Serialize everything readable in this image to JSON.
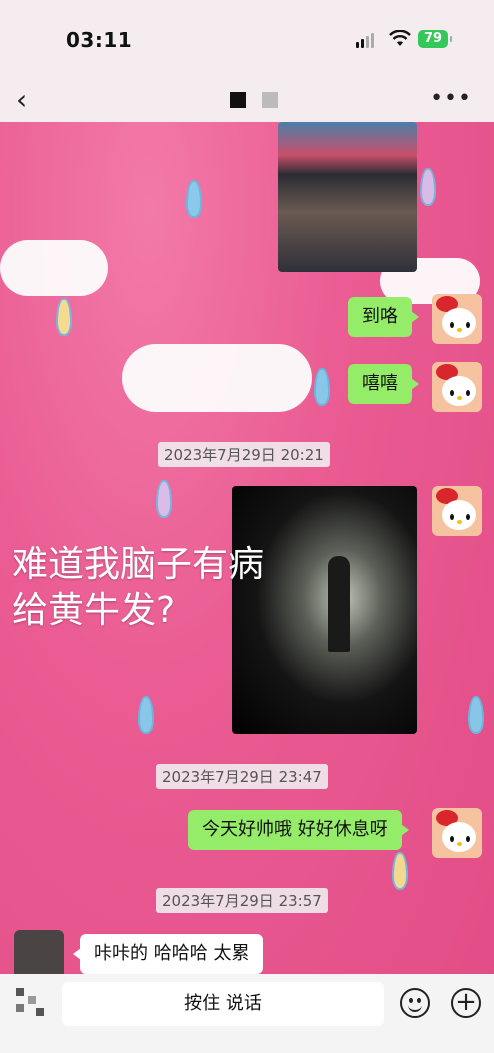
{
  "status_bar": {
    "time": "03:11",
    "battery": "79"
  },
  "nav": {
    "back_icon": "‹",
    "more_icon": "•••"
  },
  "messages": [
    {
      "type": "image",
      "from": "me",
      "desc_icon": "concert-crowd-photo"
    },
    {
      "type": "text",
      "from": "me",
      "text": "到咯"
    },
    {
      "type": "text",
      "from": "me",
      "text": "嘻嘻"
    },
    {
      "type": "timestamp",
      "text": "2023年7月29日 20:21"
    },
    {
      "type": "image",
      "from": "me",
      "desc_icon": "stage-performer-photo"
    },
    {
      "type": "timestamp",
      "text": "2023年7月29日 23:47"
    },
    {
      "type": "text",
      "from": "me",
      "text": "今天好帅哦 好好休息呀"
    },
    {
      "type": "timestamp",
      "text": "2023年7月29日 23:57"
    },
    {
      "type": "text",
      "from": "other",
      "text": "咔咔的  哈哈哈  太累"
    }
  ],
  "overlay": {
    "line1": "难道我脑子有病",
    "line2": "给黄牛发?"
  },
  "input_bar": {
    "hold_to_talk": "按住 说话",
    "plus": "+"
  },
  "colors": {
    "bubble_out": "#95ec69",
    "background": "#e8578f",
    "battery": "#34c759"
  }
}
